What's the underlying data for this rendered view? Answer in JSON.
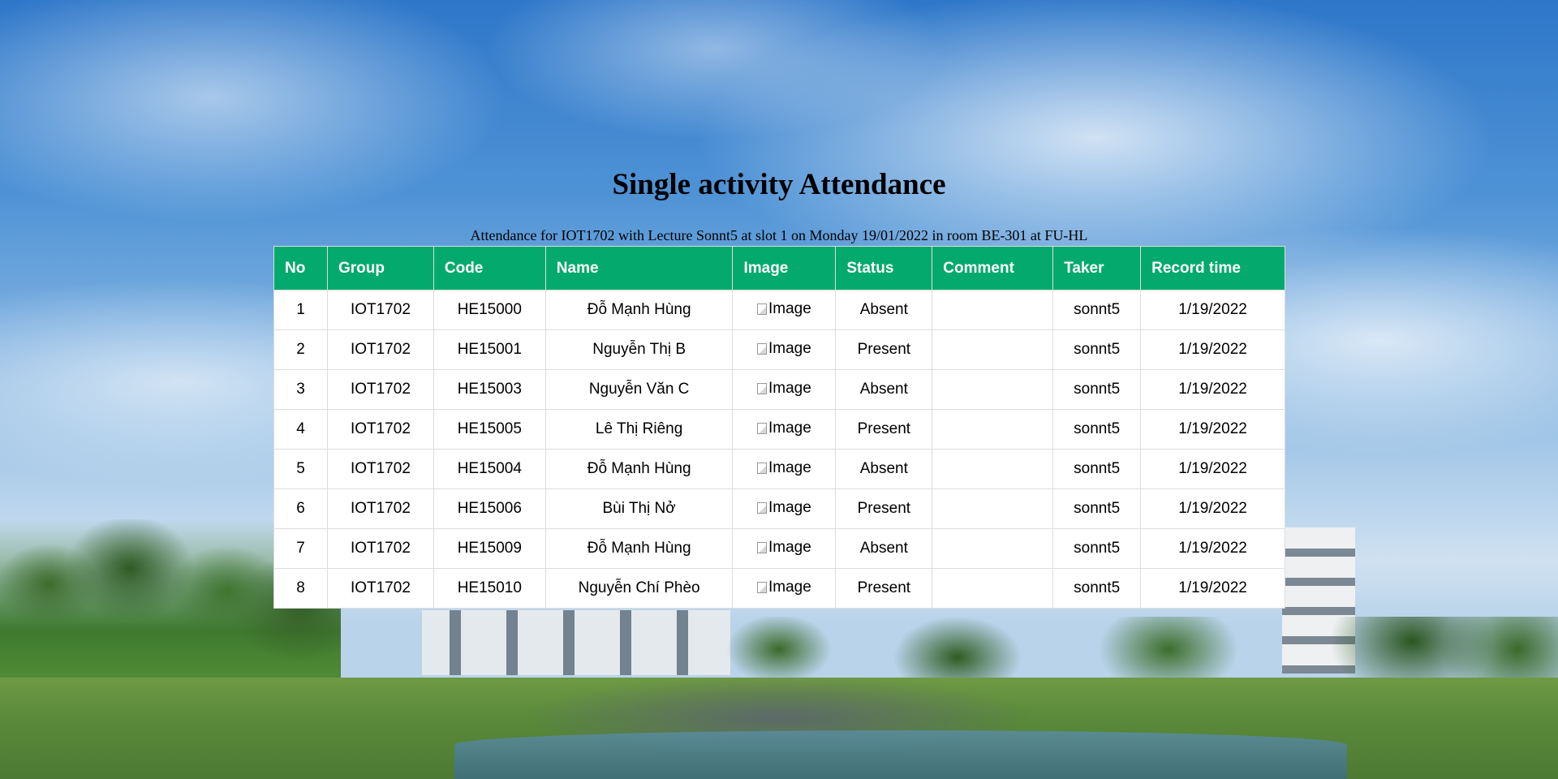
{
  "page": {
    "title": "Single activity Attendance",
    "subtitle": "Attendance for IOT1702 with Lecture Sonnt5 at slot 1 on Monday 19/01/2022 in room BE-301 at FU-HL"
  },
  "table": {
    "headers": [
      "No",
      "Group",
      "Code",
      "Name",
      "Image",
      "Status",
      "Comment",
      "Taker",
      "Record time"
    ],
    "rows": [
      {
        "no": "1",
        "group": "IOT1702",
        "code": "HE15000",
        "name": "Đỗ Mạnh Hùng",
        "image_alt": "Image",
        "status": "Absent",
        "comment": "",
        "taker": "sonnt5",
        "record_time": "1/19/2022"
      },
      {
        "no": "2",
        "group": "IOT1702",
        "code": "HE15001",
        "name": "Nguyễn Thị B",
        "image_alt": "Image",
        "status": "Present",
        "comment": "",
        "taker": "sonnt5",
        "record_time": "1/19/2022"
      },
      {
        "no": "3",
        "group": "IOT1702",
        "code": "HE15003",
        "name": "Nguyễn Văn C",
        "image_alt": "Image",
        "status": "Absent",
        "comment": "",
        "taker": "sonnt5",
        "record_time": "1/19/2022"
      },
      {
        "no": "4",
        "group": "IOT1702",
        "code": "HE15005",
        "name": "Lê Thị Riêng",
        "image_alt": "Image",
        "status": "Present",
        "comment": "",
        "taker": "sonnt5",
        "record_time": "1/19/2022"
      },
      {
        "no": "5",
        "group": "IOT1702",
        "code": "HE15004",
        "name": "Đỗ Mạnh Hùng",
        "image_alt": "Image",
        "status": "Absent",
        "comment": "",
        "taker": "sonnt5",
        "record_time": "1/19/2022"
      },
      {
        "no": "6",
        "group": "IOT1702",
        "code": "HE15006",
        "name": "Bùi Thị Nở",
        "image_alt": "Image",
        "status": "Present",
        "comment": "",
        "taker": "sonnt5",
        "record_time": "1/19/2022"
      },
      {
        "no": "7",
        "group": "IOT1702",
        "code": "HE15009",
        "name": "Đỗ Mạnh Hùng",
        "image_alt": "Image",
        "status": "Absent",
        "comment": "",
        "taker": "sonnt5",
        "record_time": "1/19/2022"
      },
      {
        "no": "8",
        "group": "IOT1702",
        "code": "HE15010",
        "name": "Nguyễn Chí Phèo",
        "image_alt": "Image",
        "status": "Present",
        "comment": "",
        "taker": "sonnt5",
        "record_time": "1/19/2022"
      }
    ]
  },
  "colors": {
    "header_bg": "#04aa6d",
    "header_text": "#ffffff",
    "row_bg": "#ffffff",
    "border": "#dddddd"
  }
}
